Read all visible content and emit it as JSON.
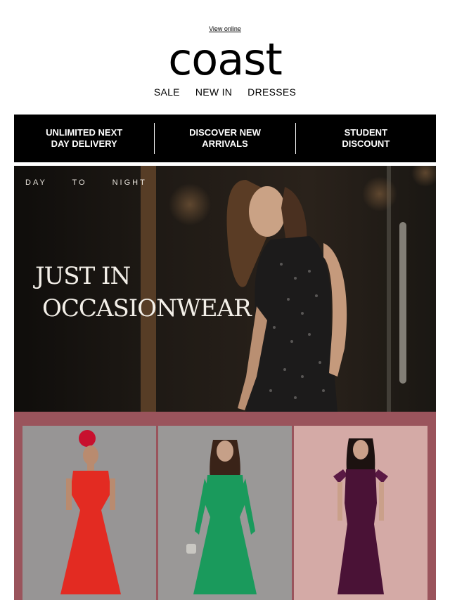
{
  "header": {
    "view_online": "View online",
    "logo": "coast",
    "nav": [
      "SALE",
      "NEW IN",
      "DRESSES"
    ]
  },
  "promo": {
    "items": [
      {
        "label": "UNLIMITED NEXT\nDAY DELIVERY"
      },
      {
        "label": "DISCOVER NEW\nARRIVALS"
      },
      {
        "label": "STUDENT\nDISCOUNT"
      }
    ]
  },
  "hero": {
    "tag": "DAY TO NIGHT",
    "title_line1": "JUST IN",
    "title_line2": "OCCASIONWEAR"
  },
  "products": [
    {
      "dress_color": "#e32b22"
    },
    {
      "dress_color": "#1a9a5c"
    },
    {
      "dress_color": "#4a1236"
    }
  ],
  "colors": {
    "promo_bg": "#000000",
    "products_bg": "#9a545c"
  }
}
